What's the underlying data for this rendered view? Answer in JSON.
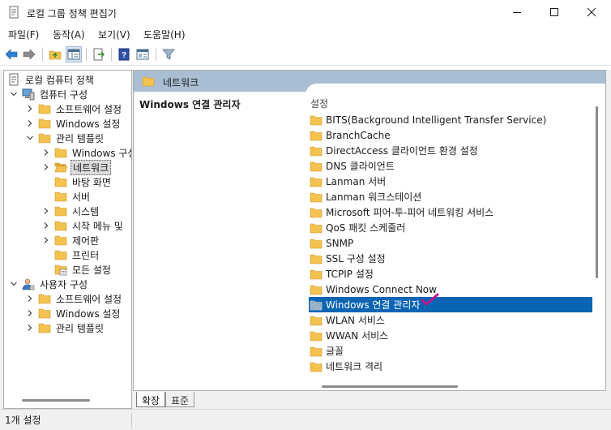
{
  "window": {
    "title": "로컬 그룹 정책 편집기"
  },
  "menu": [
    "파일(F)",
    "동작(A)",
    "보기(V)",
    "도움말(H)"
  ],
  "toolbar": {
    "icons": [
      "back-arrow-icon",
      "forward-arrow-icon",
      "up-folder-icon",
      "show-hide-tree-icon",
      "export-list-icon",
      "help-icon",
      "properties-icon",
      "filter-icon"
    ]
  },
  "tree": {
    "items": [
      {
        "label": "로컬 컴퓨터 정책",
        "icon": "policy-icon"
      },
      {
        "label": "컴퓨터 구성",
        "icon": "computer-icon"
      },
      {
        "label": "소프트웨어 설정",
        "icon": "folder-icon"
      },
      {
        "label": "Windows 설정",
        "icon": "folder-icon"
      },
      {
        "label": "관리 템플릿",
        "icon": "folder-icon"
      },
      {
        "label": "Windows 구성",
        "icon": "folder-icon"
      },
      {
        "label": "네트워크",
        "icon": "folder-open-icon"
      },
      {
        "label": "바탕 화면",
        "icon": "folder-icon"
      },
      {
        "label": "서버",
        "icon": "folder-icon"
      },
      {
        "label": "시스템",
        "icon": "folder-icon"
      },
      {
        "label": "시작 메뉴 및",
        "icon": "folder-icon"
      },
      {
        "label": "제어판",
        "icon": "folder-icon"
      },
      {
        "label": "프린터",
        "icon": "folder-icon"
      },
      {
        "label": "모든 설정",
        "icon": "all-settings-icon"
      },
      {
        "label": "사용자 구성",
        "icon": "user-icon"
      },
      {
        "label": "소프트웨어 설정",
        "icon": "folder-icon"
      },
      {
        "label": "Windows 설정",
        "icon": "folder-icon"
      },
      {
        "label": "관리 템플릿",
        "icon": "folder-icon"
      }
    ]
  },
  "header": {
    "label": "네트워크"
  },
  "description": {
    "title": "Windows 연결 관리자"
  },
  "list": {
    "header": "설정",
    "items": [
      {
        "label": "BITS(Background Intelligent Transfer Service)",
        "icon": "folder-icon"
      },
      {
        "label": "BranchCache",
        "icon": "folder-icon"
      },
      {
        "label": "DirectAccess 클라이언트 환경 설정",
        "icon": "folder-icon"
      },
      {
        "label": "DNS 클라이언트",
        "icon": "folder-icon"
      },
      {
        "label": "Lanman 서버",
        "icon": "folder-icon"
      },
      {
        "label": "Lanman 워크스테이션",
        "icon": "folder-icon"
      },
      {
        "label": "Microsoft 피어-투-피어 네트워킹 서비스",
        "icon": "folder-icon"
      },
      {
        "label": "QoS 패킷 스케줄러",
        "icon": "folder-icon"
      },
      {
        "label": "SNMP",
        "icon": "folder-icon"
      },
      {
        "label": "SSL 구성 설정",
        "icon": "folder-icon"
      },
      {
        "label": "TCPIP 설정",
        "icon": "folder-icon"
      },
      {
        "label": "Windows Connect Now",
        "icon": "folder-icon"
      },
      {
        "label": "Windows 연결 관리자",
        "icon": "selected-folder-icon"
      },
      {
        "label": "WLAN 서비스",
        "icon": "folder-icon"
      },
      {
        "label": "WWAN 서비스",
        "icon": "folder-icon"
      },
      {
        "label": "글꼴",
        "icon": "folder-icon"
      },
      {
        "label": "네트워크 격리",
        "icon": "folder-icon"
      }
    ]
  },
  "tabs": [
    "확장",
    "표준"
  ],
  "status": {
    "text": "1개 설정"
  },
  "colors": {
    "selection": "#0a64b4",
    "header_band": "#a9bed3",
    "folder": "#f4c24e",
    "annotation": "#c0168b"
  }
}
